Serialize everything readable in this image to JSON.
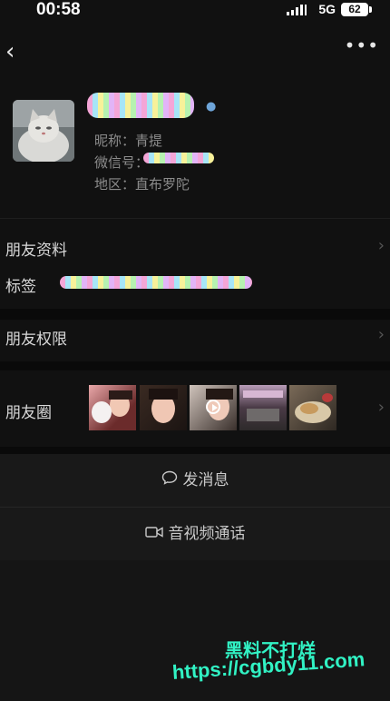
{
  "status_bar": {
    "time": "00:58",
    "network": "5G",
    "battery": "62"
  },
  "profile": {
    "nickname_label": "昵称：青提",
    "wechat_id_label": "微信号：",
    "region_label": "地区：直布罗陀"
  },
  "rows": {
    "friend_info": "朋友资料",
    "tags": "标签",
    "permissions": "朋友权限",
    "moments": "朋友圈"
  },
  "actions": {
    "send_message": "发消息",
    "voice_video_call": "音视频通话"
  },
  "watermark": {
    "line1": "黑料不打烊",
    "line2": "https://cgbdy11.com"
  },
  "icons": {
    "back": "chevron-left-icon",
    "more": "more-dots-icon",
    "message": "chat-bubble-icon",
    "video": "video-camera-icon",
    "verified": "person-icon"
  }
}
